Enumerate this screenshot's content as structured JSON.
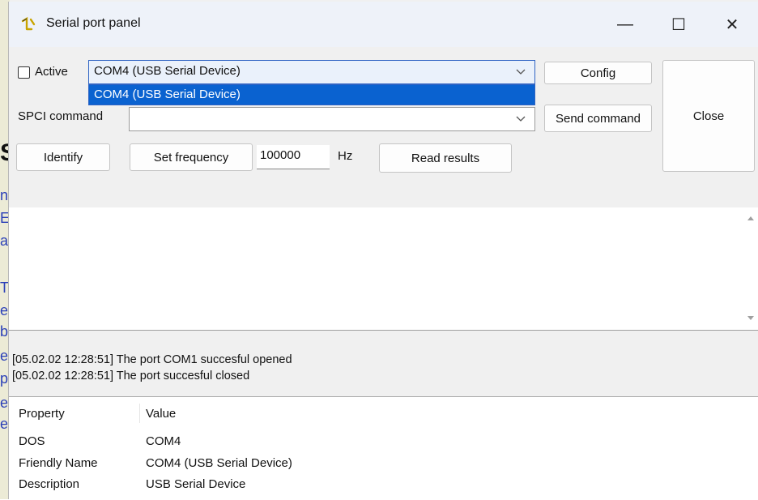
{
  "window": {
    "title": "Serial port panel",
    "controls": {
      "minimize": "—",
      "maximize": "☐",
      "close": "✕"
    }
  },
  "controls": {
    "active_label": "Active",
    "active_checked": false,
    "port_combo_value": "COM4 (USB Serial Device)",
    "port_options": [
      "COM4 (USB Serial Device)"
    ],
    "config_label": "Config",
    "close_label": "Close",
    "spci_label": "SPCI command",
    "spci_value": "",
    "send_label": "Send command",
    "identify_label": "Identify",
    "set_freq_label": "Set frequency",
    "frequency_value": "100000",
    "hz_label": "Hz",
    "read_results_label": "Read results"
  },
  "log": [
    "[05.02.02 12:28:51] The port COM1 succesful opened",
    "[05.02.02 12:28:51] The port succesful closed"
  ],
  "properties": {
    "headers": [
      "Property",
      "Value"
    ],
    "rows": [
      [
        "DOS",
        "COM4"
      ],
      [
        "Friendly Name",
        "COM4 (USB Serial Device)"
      ],
      [
        "Description",
        "USB Serial Device"
      ]
    ]
  },
  "icons": {
    "app": "serial-app-icon",
    "chevron": "chevron-down-icon"
  }
}
